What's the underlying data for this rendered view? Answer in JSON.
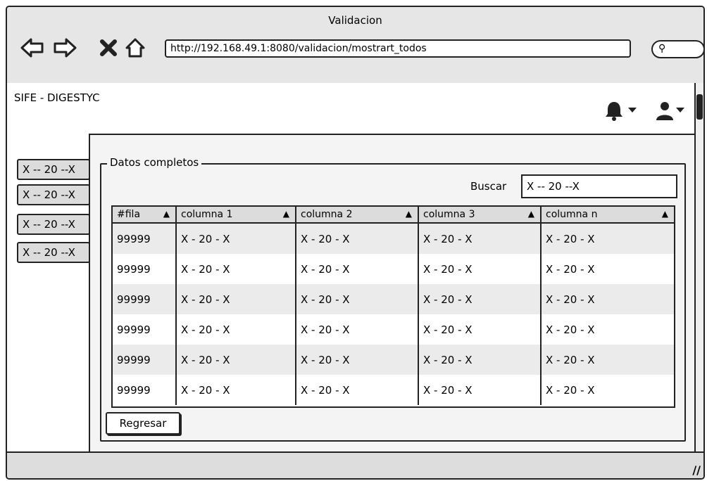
{
  "window": {
    "title": "Validacion"
  },
  "browser": {
    "url": "http://192.168.49.1:8080/validacion/mostrart_todos",
    "icons": [
      "back-arrow-icon",
      "forward-arrow-icon",
      "stop-icon",
      "home-icon",
      "search-icon"
    ]
  },
  "app": {
    "brand": "SIFE - DIGESTYC"
  },
  "sidebar": {
    "items": [
      {
        "label": "X -- 20 --X"
      },
      {
        "label": "X -- 20 --X"
      },
      {
        "label": "X -- 20 --X"
      },
      {
        "label": "X -- 20 --X"
      }
    ]
  },
  "panel": {
    "legend": "Datos completos",
    "search": {
      "label": "Buscar",
      "value": "X -- 20 --X"
    },
    "table": {
      "columns": [
        "#fila",
        "columna 1",
        "columna 2",
        "columna 3",
        "columna n"
      ],
      "rows": [
        [
          "99999",
          "X - 20 - X",
          "X - 20 - X",
          "X - 20 - X",
          "X - 20 - X"
        ],
        [
          "99999",
          "X - 20 - X",
          "X - 20 - X",
          "X - 20 - X",
          "X - 20 - X"
        ],
        [
          "99999",
          "X - 20 - X",
          "X - 20 - X",
          "X - 20 - X",
          "X - 20 - X"
        ],
        [
          "99999",
          "X - 20 - X",
          "X - 20 - X",
          "X - 20 - X",
          "X - 20 - X"
        ],
        [
          "99999",
          "X - 20 - X",
          "X - 20 - X",
          "X - 20 - X",
          "X - 20 - X"
        ],
        [
          "99999",
          "X - 20 - X",
          "X - 20 - X",
          "X - 20 - X",
          "X - 20 - X"
        ]
      ]
    },
    "back_button": "Regresar"
  }
}
